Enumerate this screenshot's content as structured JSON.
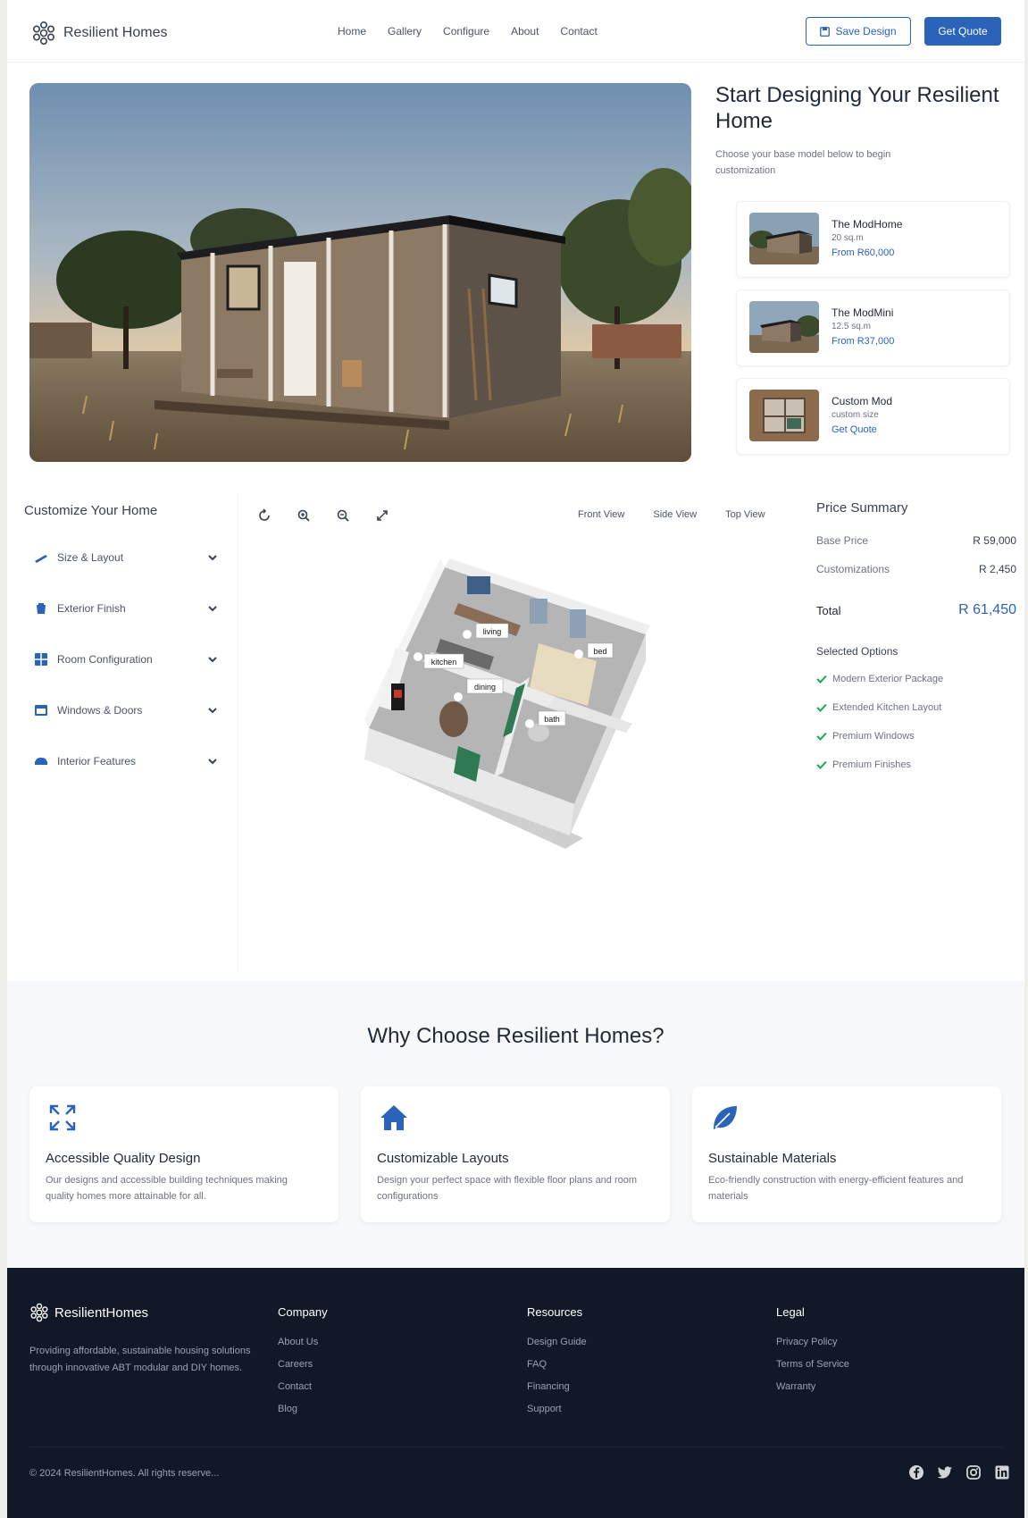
{
  "header": {
    "brand": "Resilient Homes",
    "nav": [
      "Home",
      "Gallery",
      "Configure",
      "About",
      "Contact"
    ],
    "save_label": "Save Design",
    "quote_label": "Get Quote"
  },
  "start": {
    "title": "Start Designing Your Resilient Home",
    "subtitle": "Choose your base model below to begin customization",
    "models": [
      {
        "name": "The ModHome",
        "size": "20 sq.m",
        "price": "From R60,000"
      },
      {
        "name": "The ModMini",
        "size": "12.5 sq.m",
        "price": "From R37,000"
      },
      {
        "name": "Custom Mod",
        "size": "custom size",
        "price": "Get Quote"
      }
    ]
  },
  "customize": {
    "title": "Customize Your Home",
    "items": [
      {
        "label": "Size & Layout",
        "icon": "ruler-icon"
      },
      {
        "label": "Exterior Finish",
        "icon": "paint-bucket-icon"
      },
      {
        "label": "Room Configuration",
        "icon": "grid-icon"
      },
      {
        "label": "Windows & Doors",
        "icon": "window-icon"
      },
      {
        "label": "Interior Features",
        "icon": "couch-icon"
      }
    ],
    "tools": [
      "rotate-icon",
      "zoom-in-icon",
      "zoom-out-icon",
      "expand-icon"
    ],
    "views": [
      "Front View",
      "Side View",
      "Top View"
    ],
    "room_labels": [
      "living",
      "bed",
      "kitchen",
      "dining",
      "bath"
    ]
  },
  "price": {
    "title": "Price Summary",
    "base_label": "Base Price",
    "base_value": "R 59,000",
    "custom_label": "Customizations",
    "custom_value": "R 2,450",
    "total_label": "Total",
    "total_value": "R 61,450",
    "selected_title": "Selected Options",
    "options": [
      "Modern Exterior Package",
      "Extended Kitchen Layout",
      "Premium Windows",
      "Premium Finishes"
    ]
  },
  "why": {
    "title": "Why Choose Resilient Homes?",
    "features": [
      {
        "title": "Accessible Quality Design",
        "desc": "Our designs and accessible building techniques making quality homes more attainable for all."
      },
      {
        "title": "Customizable Layouts",
        "desc": "Design your perfect space with flexible floor plans and room configurations"
      },
      {
        "title": "Sustainable Materials",
        "desc": "Eco-friendly construction with energy-efficient features and materials"
      }
    ]
  },
  "footer": {
    "brand": "ResilientHomes",
    "desc": "Providing affordable, sustainable housing solutions through innovative ABT modular and DIY homes.",
    "columns": [
      {
        "title": "Company",
        "links": [
          "About Us",
          "Careers",
          "Contact",
          "Blog"
        ]
      },
      {
        "title": "Resources",
        "links": [
          "Design Guide",
          "FAQ",
          "Financing",
          "Support"
        ]
      },
      {
        "title": "Legal",
        "links": [
          "Privacy Policy",
          "Terms of Service",
          "Warranty"
        ]
      }
    ],
    "copyright": "© 2024 ResilientHomes. All rights reserve...",
    "social": [
      "facebook-icon",
      "twitter-icon",
      "instagram-icon",
      "linkedin-icon"
    ]
  },
  "colors": {
    "accent": "#2a63b8",
    "footer_bg": "#111827",
    "check": "#22a352"
  }
}
